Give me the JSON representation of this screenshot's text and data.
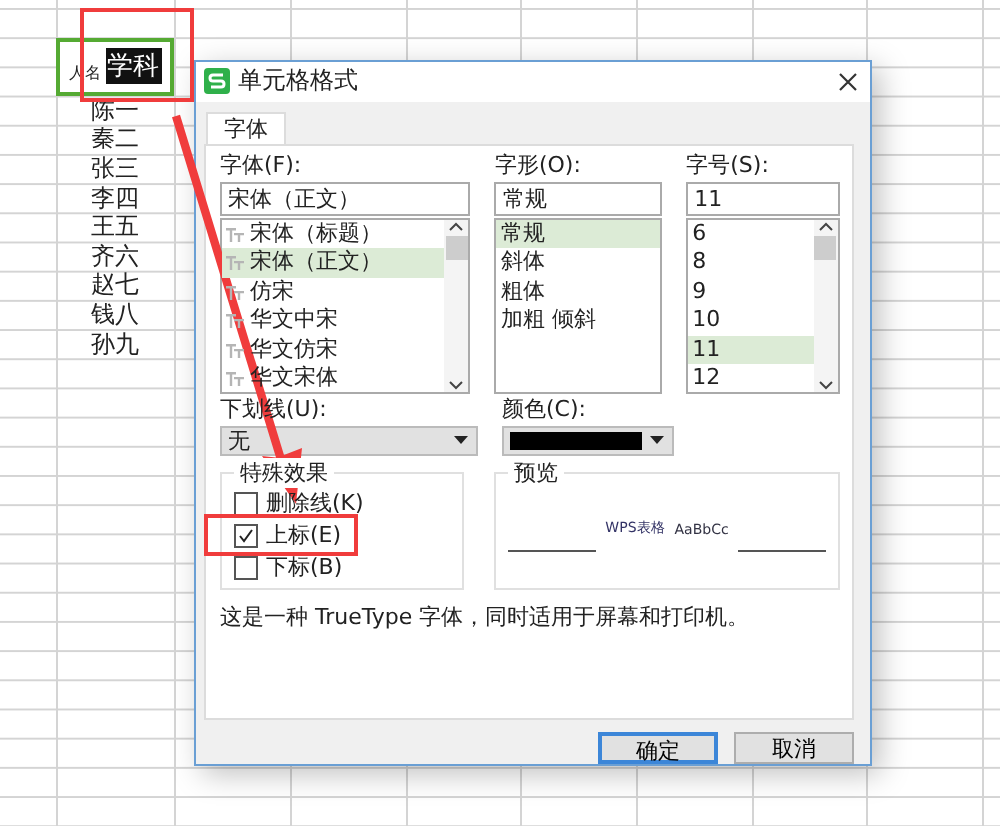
{
  "sheet": {
    "header": {
      "label": "人名",
      "selected_text": "学科"
    },
    "names": [
      "陈一",
      "秦二",
      "张三",
      "李四",
      "王五",
      "齐六",
      "赵七",
      "钱八",
      "孙九"
    ]
  },
  "dialog": {
    "title": "单元格格式",
    "tabs": [
      {
        "label": "字体",
        "selected": true
      }
    ],
    "font": {
      "label": "字体(F):",
      "value": "宋体（正文）",
      "items": [
        {
          "label": "宋体（标题）",
          "selected": false
        },
        {
          "label": "宋体（正文）",
          "selected": true
        },
        {
          "label": "仿宋",
          "selected": false
        },
        {
          "label": "华文中宋",
          "selected": false
        },
        {
          "label": "华文仿宋",
          "selected": false
        },
        {
          "label": "华文宋体",
          "selected": false
        }
      ]
    },
    "style": {
      "label": "字形(O):",
      "value": "常规",
      "items": [
        {
          "label": "常规",
          "selected": true
        },
        {
          "label": "斜体",
          "selected": false
        },
        {
          "label": "粗体",
          "selected": false
        },
        {
          "label": "加粗 倾斜",
          "selected": false
        }
      ]
    },
    "size": {
      "label": "字号(S):",
      "value": "11",
      "items": [
        {
          "label": "6",
          "selected": false
        },
        {
          "label": "8",
          "selected": false
        },
        {
          "label": "9",
          "selected": false
        },
        {
          "label": "10",
          "selected": false
        },
        {
          "label": "11",
          "selected": true
        },
        {
          "label": "12",
          "selected": false
        }
      ]
    },
    "underline": {
      "label": "下划线(U):",
      "value": "无"
    },
    "color": {
      "label": "颜色(C):",
      "color": "#000000"
    },
    "effects": {
      "title": "特殊效果",
      "options": [
        {
          "label": "删除线(K)",
          "checked": false
        },
        {
          "label": "上标(E)",
          "checked": true
        },
        {
          "label": "下标(B)",
          "checked": false
        }
      ]
    },
    "preview": {
      "title": "预览",
      "samples": [
        "WPS表格",
        "AaBbCc"
      ]
    },
    "description": "这是一种 TrueType 字体，同时适用于屏幕和打印机。",
    "buttons": [
      {
        "label": "确定",
        "default": true
      },
      {
        "label": "取消",
        "default": false
      }
    ]
  }
}
